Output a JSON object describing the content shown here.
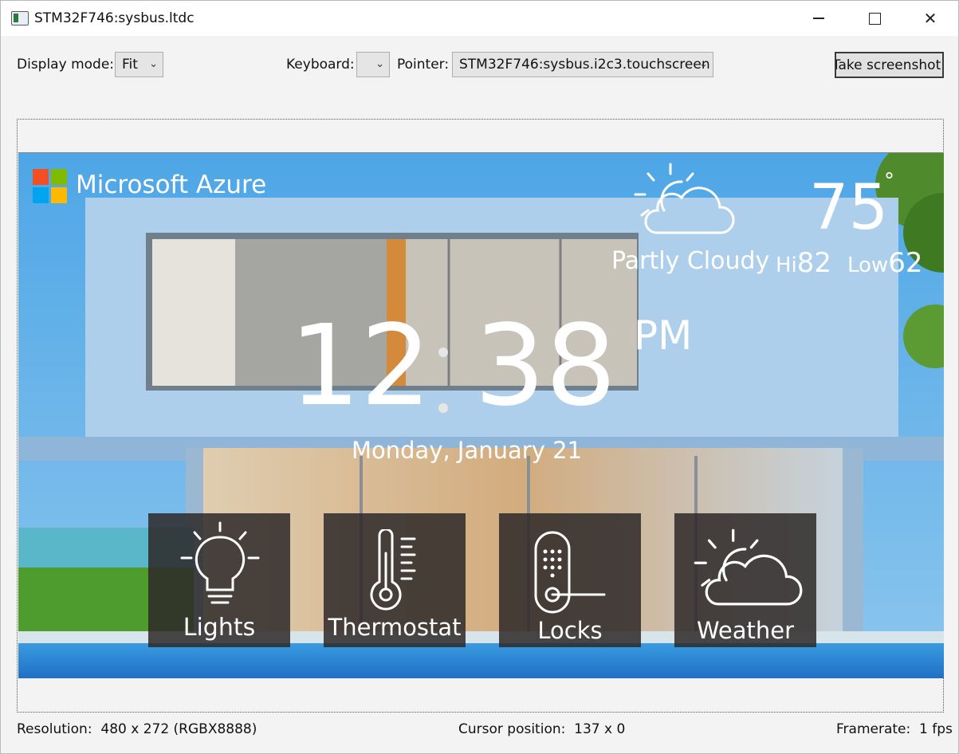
{
  "window": {
    "title": "STM32F746:sysbus.ltdc",
    "controls": {
      "minimize": "—",
      "maximize": "□",
      "close": "✕"
    }
  },
  "toolbar": {
    "display_mode_label": "Display mode:",
    "display_mode_value": "Fit",
    "keyboard_label": "Keyboard:",
    "keyboard_value": "",
    "pointer_label": "Pointer:",
    "pointer_value": "STM32F746:sysbus.i2c3.touchscreen",
    "screenshot_button": "Take screenshot!"
  },
  "screen": {
    "brand": "Microsoft Azure",
    "temperature": "75",
    "degree": "°",
    "condition": "Partly Cloudy",
    "hi_label": "Hi",
    "hi_value": "82",
    "low_label": "Low",
    "low_value": "62",
    "time_hours": "12",
    "time_minutes": "38",
    "time_ampm": "PM",
    "date": "Monday, January 21",
    "tiles": [
      {
        "label": "Lights",
        "icon": "lightbulb-icon"
      },
      {
        "label": "Thermostat",
        "icon": "thermometer-icon"
      },
      {
        "label": "Locks",
        "icon": "door-lock-icon"
      },
      {
        "label": "Weather",
        "icon": "partly-cloudy-icon"
      }
    ],
    "colors": {
      "sky": "#5aaee8",
      "facade": "#9cc4e6",
      "tile": "#3b3636",
      "pool": "#2f86d6"
    }
  },
  "status": {
    "resolution_label": "Resolution:",
    "resolution_value": "480 x 272 (RGBX8888)",
    "cursor_label": "Cursor position:",
    "cursor_value": "137 x 0",
    "framerate_label": "Framerate:",
    "framerate_value": "1 fps"
  }
}
